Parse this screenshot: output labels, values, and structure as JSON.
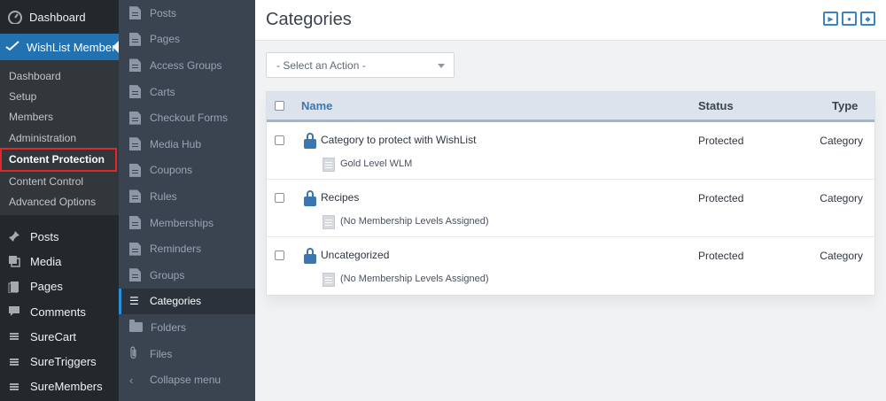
{
  "admin_menu": {
    "dashboard": "Dashboard",
    "wishlist": "WishList Member",
    "submenu": [
      "Dashboard",
      "Setup",
      "Members",
      "Administration",
      "Content Protection",
      "Content Control",
      "Advanced Options"
    ],
    "current_submenu": "Content Protection",
    "main": [
      {
        "label": "Posts",
        "icon": "pin-icon"
      },
      {
        "label": "Media",
        "icon": "media-icon"
      },
      {
        "label": "Pages",
        "icon": "pages-icon"
      },
      {
        "label": "Comments",
        "icon": "comments-icon"
      },
      {
        "label": "SureCart",
        "icon": "surecart-icon"
      },
      {
        "label": "SureTriggers",
        "icon": "suretriggers-icon"
      },
      {
        "label": "SureMembers",
        "icon": "suremembers-icon"
      }
    ]
  },
  "wl_sidebar": {
    "items": [
      "Posts",
      "Pages",
      "Access Groups",
      "Carts",
      "Checkout Forms",
      "Media Hub",
      "Coupons",
      "Rules",
      "Memberships",
      "Reminders",
      "Groups"
    ],
    "active": "Categories",
    "folders": "Folders",
    "files": "Files",
    "collapse": "Collapse menu"
  },
  "page": {
    "title": "Categories",
    "action_placeholder": "- Select an Action -"
  },
  "table": {
    "headers": {
      "name": "Name",
      "status": "Status",
      "type": "Type"
    },
    "rows": [
      {
        "title": "Category to protect with WishList",
        "status": "Protected",
        "type": "Category",
        "level": "Gold Level WLM"
      },
      {
        "title": "Recipes",
        "status": "Protected",
        "type": "Category",
        "level": "(No Membership Levels Assigned)"
      },
      {
        "title": "Uncategorized",
        "status": "Protected",
        "type": "Category",
        "level": "(No Membership Levels Assigned)"
      }
    ]
  },
  "colors": {
    "accent": "#2271b1",
    "highlight_border": "#e2262a",
    "lock": "#3a77b0"
  }
}
